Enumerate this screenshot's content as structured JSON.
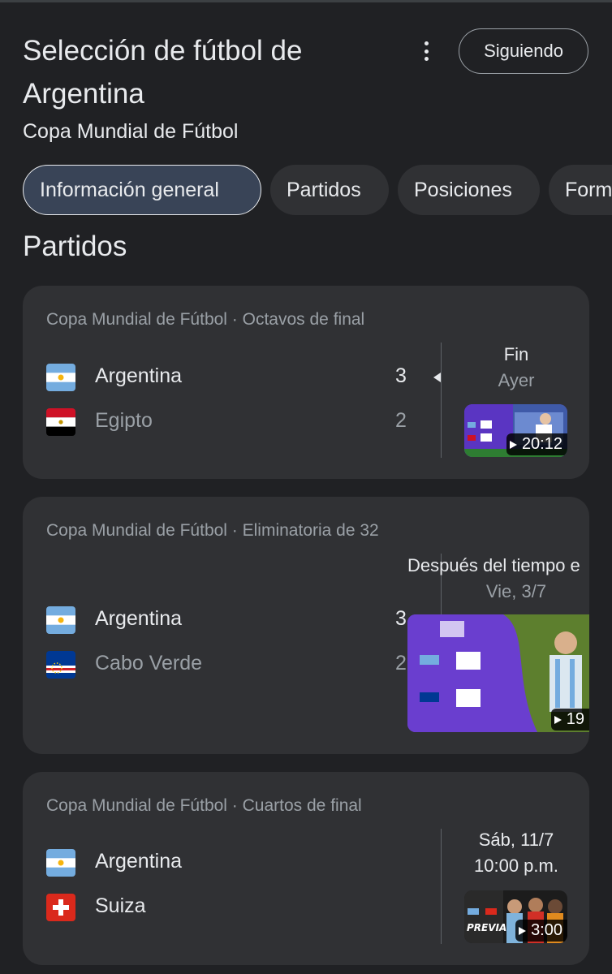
{
  "header": {
    "title": "Selección de fútbol de Argentina",
    "subtitle": "Copa Mundial de Fútbol",
    "follow_label": "Siguiendo",
    "more_icon": "more-vert-icon"
  },
  "tabs": [
    {
      "label": "Información general",
      "active": true
    },
    {
      "label": "Partidos",
      "active": false
    },
    {
      "label": "Posiciones",
      "active": false
    },
    {
      "label": "Form",
      "active": false
    }
  ],
  "section_title": "Partidos",
  "matches": [
    {
      "competition": "Copa Mundial de Fútbol · Octavos de final",
      "home": {
        "name": "Argentina",
        "score": "3",
        "flag": "argentina-flag-icon",
        "winner": true
      },
      "away": {
        "name": "Egipto",
        "score": "2",
        "flag": "egypt-flag-icon",
        "winner": false
      },
      "status": "Fin",
      "date": "Ayer",
      "video_duration": "20:12"
    },
    {
      "competition": "Copa Mundial de Fútbol · Eliminatoria de 32",
      "home": {
        "name": "Argentina",
        "score": "3",
        "flag": "argentina-flag-icon",
        "winner": true
      },
      "away": {
        "name": "Cabo Verde",
        "score": "2",
        "flag": "cape-verde-flag-icon",
        "winner": false
      },
      "status": "Después del tiempo e",
      "date": "Vie, 3/7",
      "video_duration": "19"
    },
    {
      "competition": "Copa Mundial de Fútbol · Cuartos de final",
      "home": {
        "name": "Argentina",
        "flag": "argentina-flag-icon"
      },
      "away": {
        "name": "Suiza",
        "flag": "switzerland-flag-icon"
      },
      "date": "Sáb, 11/7",
      "time": "10:00 p.m.",
      "video_duration": "3:00",
      "thumb_text": "PREVIA"
    }
  ],
  "colors": {
    "background": "#202124",
    "card": "#303134",
    "active_tab": "#394457",
    "muted_text": "#9aa0a6"
  }
}
